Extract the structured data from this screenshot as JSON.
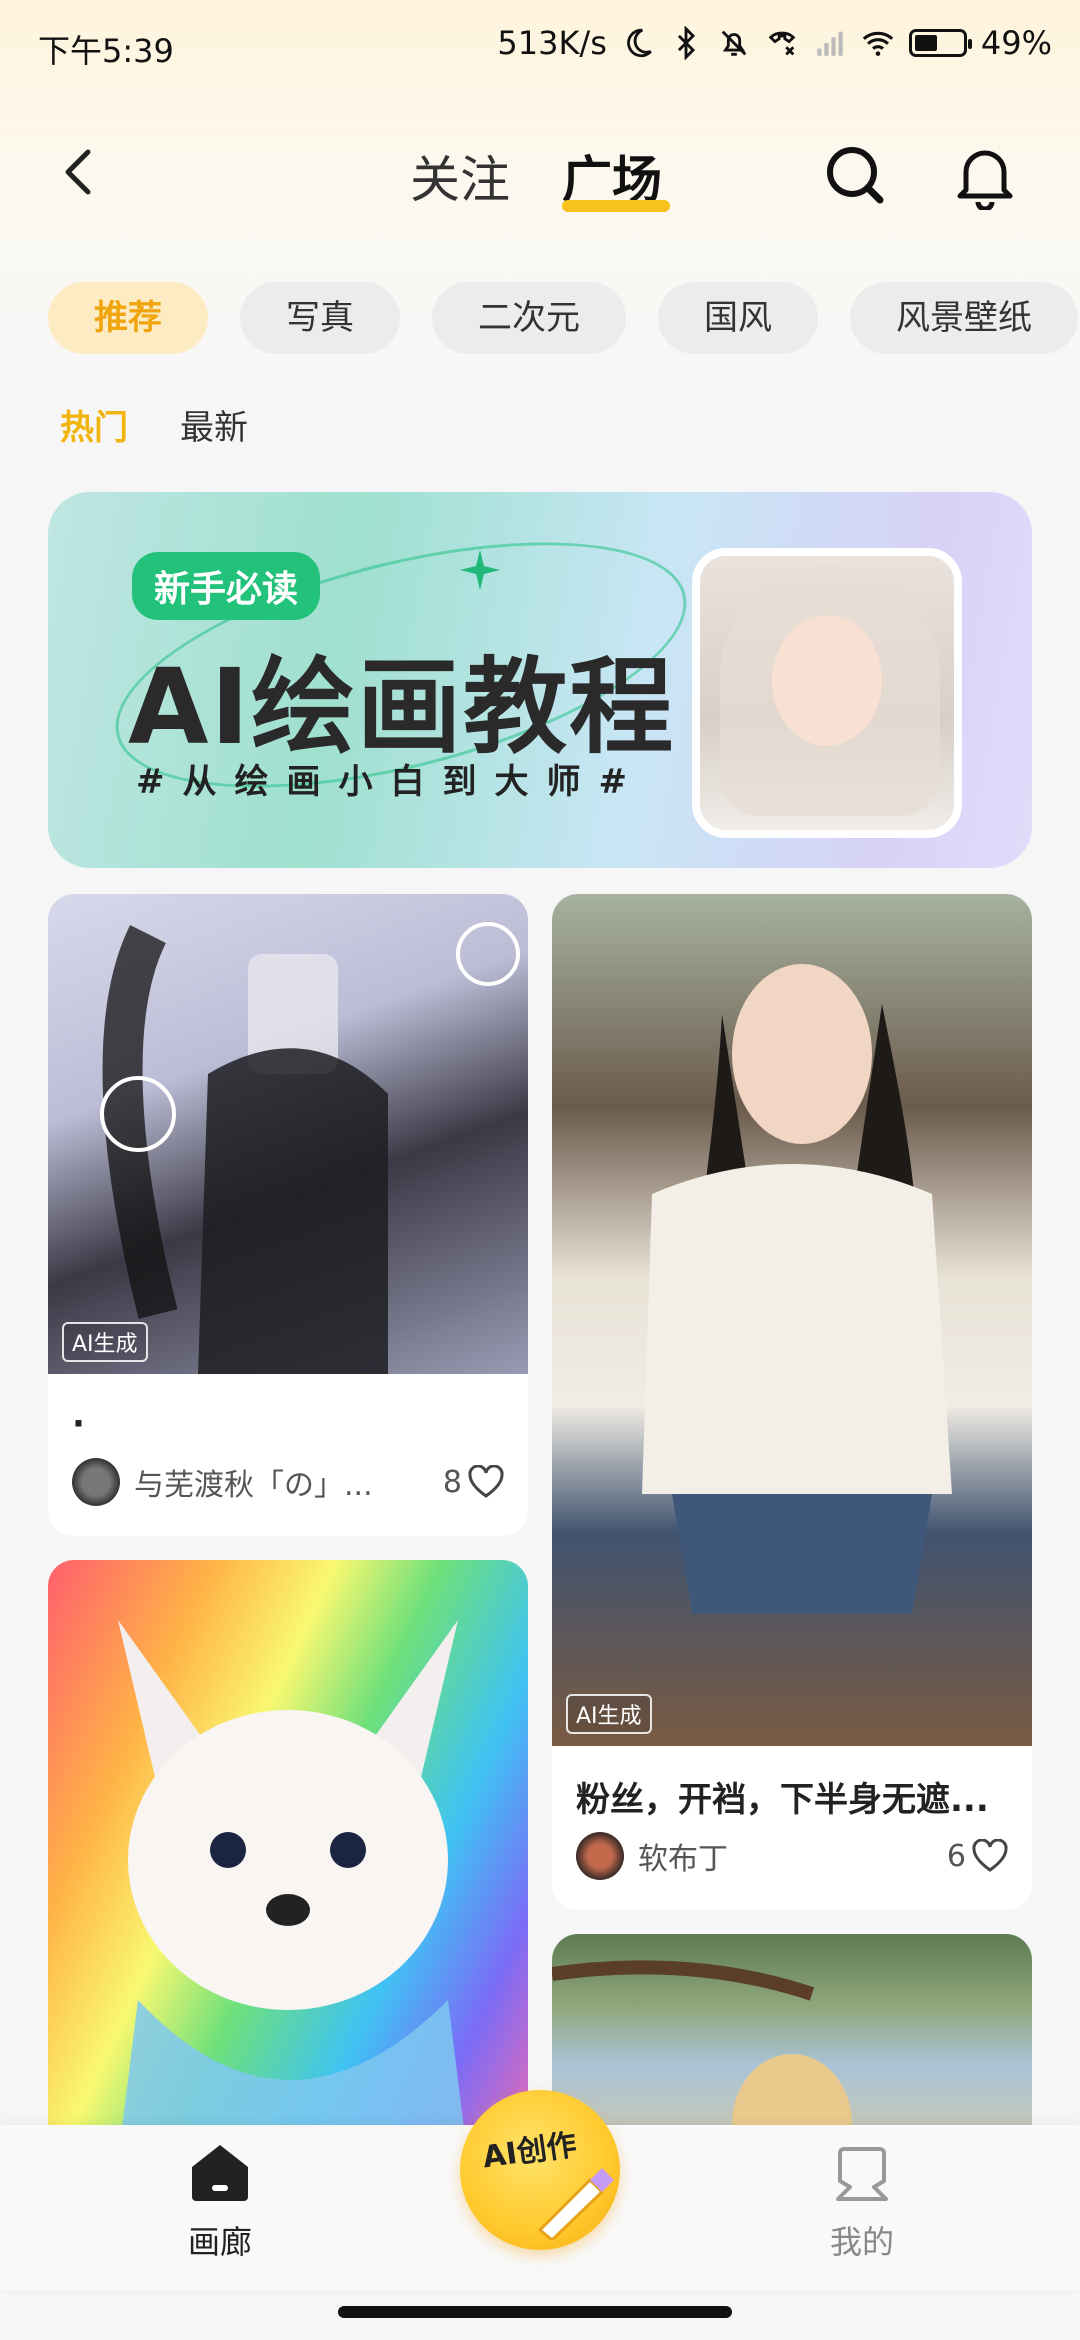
{
  "status_bar": {
    "time": "下午5:39",
    "net_speed": "513K/s",
    "battery": "49%",
    "battery_level": 0.49
  },
  "header": {
    "tabs": [
      {
        "label": "关注",
        "active": false
      },
      {
        "label": "广场",
        "active": true
      }
    ],
    "accent_color": "#f7c21c"
  },
  "categories": [
    {
      "label": "推荐",
      "active": true
    },
    {
      "label": "写真",
      "active": false
    },
    {
      "label": "二次元",
      "active": false
    },
    {
      "label": "国风",
      "active": false
    },
    {
      "label": "风景壁纸",
      "active": false
    }
  ],
  "subtabs": [
    {
      "label": "热门",
      "active": true
    },
    {
      "label": "最新",
      "active": false
    }
  ],
  "banner": {
    "badge": "新手必读",
    "title": "AI绘画教程",
    "subtitle": "#从绘画小白到大师#"
  },
  "feed": {
    "cards": [
      {
        "ai_tag": "AI生成",
        "caption": "·",
        "author": "与芜渡秋「の」...",
        "likes": "8"
      },
      {
        "ai_tag": "AI生成",
        "caption": "粉丝，开裆，下半身无遮...",
        "author": "软布丁",
        "likes": "6"
      },
      {
        "ai_tag": "",
        "caption": "",
        "author": "",
        "likes": ""
      },
      {
        "ai_tag": "",
        "caption": "",
        "author": "",
        "likes": ""
      }
    ]
  },
  "bottom_nav": {
    "home": "画廊",
    "create": "AI创作",
    "mine": "我的"
  }
}
